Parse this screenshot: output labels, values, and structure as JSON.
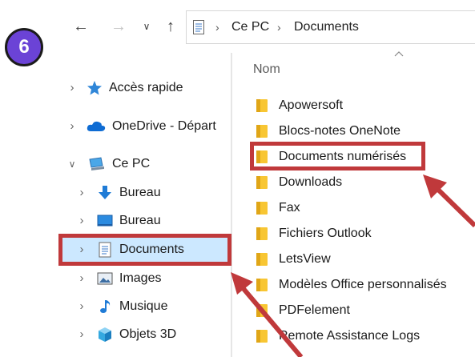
{
  "step_badge": "6",
  "breadcrumb": {
    "root": "Ce PC",
    "current": "Documents"
  },
  "column_header": "Nom",
  "tree": [
    {
      "label": "Accès rapide",
      "icon": "star-icon"
    },
    {
      "label": "OneDrive - Départ",
      "icon": "cloud-icon"
    },
    {
      "label": "Ce PC",
      "icon": "computer-icon"
    },
    {
      "label": "Bureau",
      "icon": "download-arrow-icon"
    },
    {
      "label": "Bureau",
      "icon": "desktop-icon"
    },
    {
      "label": "Documents",
      "icon": "document-icon"
    },
    {
      "label": "Images",
      "icon": "picture-icon"
    },
    {
      "label": "Musique",
      "icon": "music-note-icon"
    },
    {
      "label": "Objets 3D",
      "icon": "cube-icon"
    }
  ],
  "files": [
    "Apowersoft",
    "Blocs-notes OneNote",
    "Documents numérisés",
    "Downloads",
    "Fax",
    "Fichiers Outlook",
    "LetsView",
    "Modèles Office personnalisés",
    "PDFelement",
    "Remote Assistance Logs"
  ],
  "colors": {
    "badge": "#6b43d6",
    "annotation_red": "#c0393b",
    "selection": "#cce8ff",
    "folder": "#f8c633"
  }
}
